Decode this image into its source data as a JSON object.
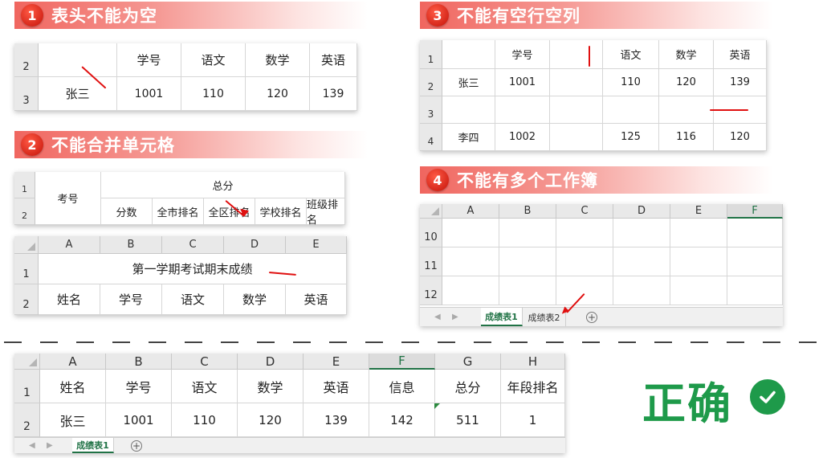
{
  "sections": {
    "s1": {
      "num": "1",
      "title": "表头不能为空"
    },
    "s2": {
      "num": "2",
      "title": "不能合并单元格"
    },
    "s3": {
      "num": "3",
      "title": "不能有空行空列"
    },
    "s4": {
      "num": "4",
      "title": "不能有多个工作簿"
    }
  },
  "t1": {
    "rows": [
      "2",
      "3"
    ],
    "headers": [
      "学号",
      "语文",
      "数学",
      "英语"
    ],
    "data": [
      "张三",
      "1001",
      "110",
      "120",
      "139"
    ]
  },
  "t2a": {
    "rows": [
      "1",
      "2"
    ],
    "kaohao": "考号",
    "total": "总分",
    "subs": [
      "分数",
      "全市排名",
      "全区排名",
      "学校排名",
      "班级排名"
    ]
  },
  "t2b": {
    "cols": [
      "A",
      "B",
      "C",
      "D",
      "E"
    ],
    "rows": [
      "1",
      "2"
    ],
    "title": "第一学期考试期末成绩",
    "headers": [
      "姓名",
      "学号",
      "语文",
      "数学",
      "英语"
    ]
  },
  "t3": {
    "rows": [
      "1",
      "2",
      "3",
      "4"
    ],
    "headers": [
      "学号",
      "",
      "语文",
      "数学",
      "英语"
    ],
    "r2": [
      "张三",
      "1001",
      "",
      "110",
      "120",
      "139"
    ],
    "r4": [
      "李四",
      "1002",
      "",
      "125",
      "116",
      "120"
    ]
  },
  "t4": {
    "cols": [
      "A",
      "B",
      "C",
      "D",
      "E",
      "F"
    ],
    "rows": [
      "10",
      "11",
      "12"
    ],
    "tabs": [
      "成绩表1",
      "成绩表2"
    ]
  },
  "t5": {
    "cols": [
      "A",
      "B",
      "C",
      "D",
      "E",
      "F",
      "G",
      "H"
    ],
    "rows": [
      "1",
      "2"
    ],
    "headers": [
      "姓名",
      "学号",
      "语文",
      "数学",
      "英语",
      "信息",
      "总分",
      "年段排名"
    ],
    "data": [
      "张三",
      "1001",
      "110",
      "120",
      "139",
      "142",
      "511",
      "1"
    ],
    "tabs": [
      "成绩表1"
    ]
  },
  "correct": {
    "label": "正确"
  },
  "colors": {
    "accent_red": "#e01010",
    "excel_green": "#217346",
    "correct_green": "#1e9a4a",
    "header_gradient": "#f0665f"
  },
  "icons": [
    "check-icon",
    "plus-icon",
    "arrow-icon"
  ]
}
